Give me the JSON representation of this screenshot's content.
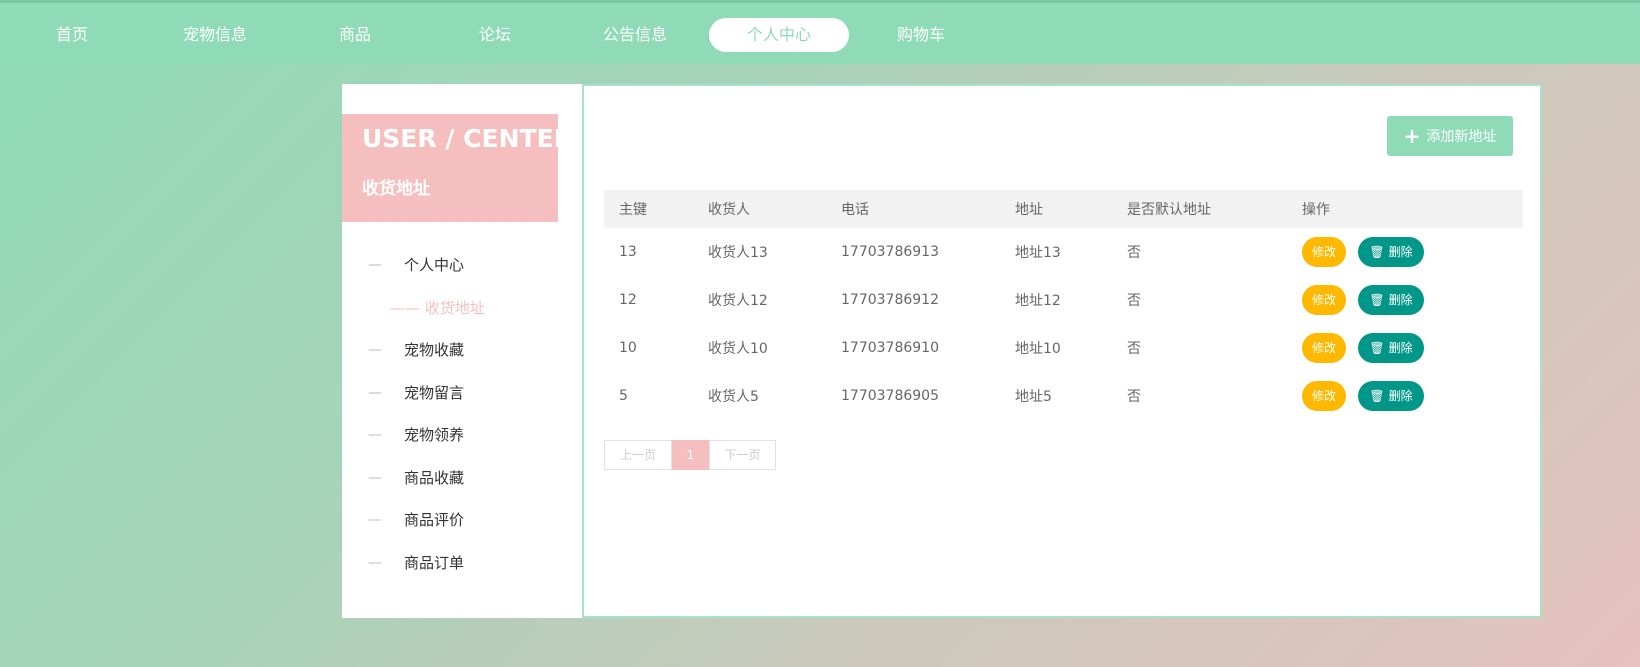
{
  "nav": {
    "items": [
      {
        "label": "首页"
      },
      {
        "label": "宠物信息"
      },
      {
        "label": "商品"
      },
      {
        "label": "论坛"
      },
      {
        "label": "公告信息"
      },
      {
        "label": "个人中心",
        "active": true
      },
      {
        "label": "购物车"
      }
    ]
  },
  "sidebar": {
    "title": "USER / CENTER",
    "subtitle": "收货地址",
    "items": [
      {
        "label": "个人中心"
      },
      {
        "label": "收货地址",
        "active": true
      },
      {
        "label": "宠物收藏"
      },
      {
        "label": "宠物留言"
      },
      {
        "label": "宠物领养"
      },
      {
        "label": "商品收藏"
      },
      {
        "label": "商品评价"
      },
      {
        "label": "商品订单"
      }
    ]
  },
  "main": {
    "add_button": "添加新地址",
    "table": {
      "headers": [
        "主键",
        "收货人",
        "电话",
        "地址",
        "是否默认地址",
        "操作"
      ],
      "rows": [
        [
          "13",
          "收货人13",
          "17703786913",
          "地址13",
          "否"
        ],
        [
          "12",
          "收货人12",
          "17703786912",
          "地址12",
          "否"
        ],
        [
          "10",
          "收货人10",
          "17703786910",
          "地址10",
          "否"
        ],
        [
          "5",
          "收货人5",
          "17703786905",
          "地址5",
          "否"
        ]
      ],
      "edit_label": "修改",
      "delete_label": "删除"
    },
    "pagination": {
      "prev": "上一页",
      "current": "1",
      "next": "下一页"
    }
  },
  "colors": {
    "primary": "#8fdbb8",
    "pink": "#f6bfbf",
    "edit": "#ffb800",
    "delete": "#009688"
  }
}
